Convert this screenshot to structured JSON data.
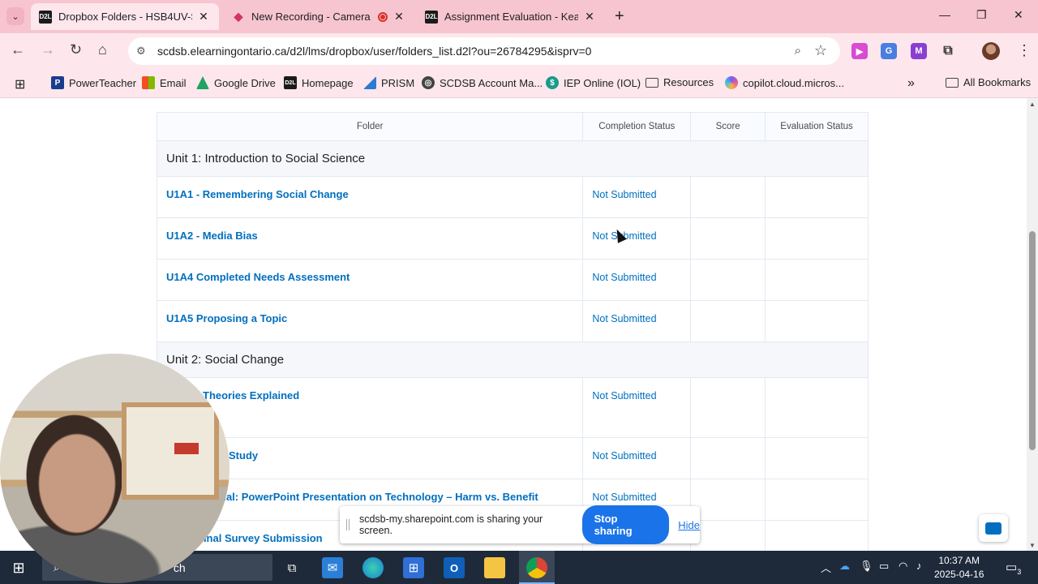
{
  "browser": {
    "tab_search_label": "⌄",
    "tabs": [
      {
        "title": "Dropbox Folders - HSB4UV-S2A",
        "favicon": "D2L"
      },
      {
        "title": "New Recording - Camera",
        "favicon": "recording"
      },
      {
        "title": "Assignment Evaluation - Keaton",
        "favicon": "D2L"
      }
    ],
    "url": "scdsb.elearningontario.ca/d2l/lms/dropbox/user/folders_list.d2l?ou=26784295&isprv=0"
  },
  "bookmarks": [
    {
      "label": "PowerTeacher",
      "icon": "P",
      "color": "#1a3c8e"
    },
    {
      "label": "Email",
      "icon": "microsoft-logo",
      "color": "#f25022"
    },
    {
      "label": "Google Drive",
      "icon": "drive",
      "color": "#1fa463"
    },
    {
      "label": "Homepage",
      "icon": "D2L",
      "color": "#1b1b1b"
    },
    {
      "label": "PRISM",
      "icon": "prism",
      "color": "#2b7bd1"
    },
    {
      "label": "SCDSB Account Ma...",
      "icon": "globe",
      "color": "#444444"
    },
    {
      "label": "IEP Online (IOL)",
      "icon": "iep",
      "color": "#1a9a8a"
    },
    {
      "label": "Resources",
      "icon": "folder",
      "color": "#444444"
    },
    {
      "label": "copilot.cloud.micros...",
      "icon": "copilot",
      "color": "#7a5cf0"
    }
  ],
  "bookmarks_more": "»",
  "all_bookmarks": "All Bookmarks",
  "table": {
    "headers": [
      "Folder",
      "Completion Status",
      "Score",
      "Evaluation Status"
    ],
    "units": [
      {
        "title": "Unit 1: Introduction to Social Science",
        "items": [
          {
            "name": "U1A1 - Remembering Social Change",
            "status": "Not Submitted"
          },
          {
            "name": "U1A2 - Media Bias",
            "status": "Not Submitted"
          },
          {
            "name": "U1A4 Completed Needs Assessment",
            "status": "Not Submitted"
          },
          {
            "name": "U1A5 Proposing a Topic",
            "status": "Not Submitted"
          }
        ]
      },
      {
        "title": "Unit 2: Social Change",
        "items": [
          {
            "name": "Theories Explained",
            "status": "Not Submitted"
          },
          {
            "name": "Study",
            "status": "Not Submitted"
          },
          {
            "name": "ual: PowerPoint Presentation on Technology – Harm vs. Benefit",
            "status": "Not Submitted"
          },
          {
            "name": "Final Survey Submission",
            "status": ""
          }
        ]
      }
    ]
  },
  "share_banner": {
    "message": "scdsb-my.sharepoint.com is sharing your screen.",
    "stop_label": "Stop sharing",
    "hide_label": "Hide"
  },
  "taskbar": {
    "search_text": "ch",
    "time": "10:37 AM",
    "date": "2025-04-16",
    "notification_count": "3"
  },
  "colors": {
    "tabstrip": "#f7c5cf",
    "toolbar": "#fde7ec",
    "link": "#006fbf",
    "stop_button": "#1a73e8",
    "taskbar": "#1e2a3a"
  }
}
